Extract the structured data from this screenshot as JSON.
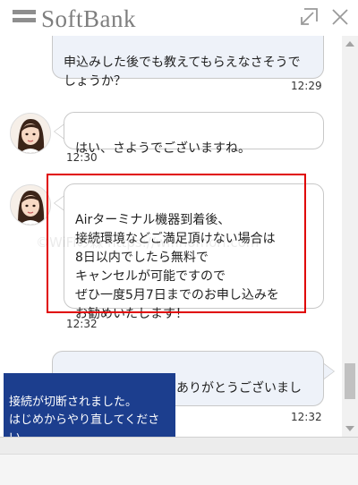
{
  "header": {
    "logo_text": "SoftBank",
    "minimize_icon": "minimize-arrow-icon",
    "close_icon": "close-icon"
  },
  "messages": [
    {
      "sender": "user",
      "text": "申込みした後でも教えてもらえなさそうで\nしょうか？",
      "time": "12:29"
    },
    {
      "sender": "agent",
      "text": "はい、さようでございますね。",
      "time": "12:30"
    },
    {
      "sender": "agent",
      "text": "Airターミナル機器到着後、\n接続環境などご満足頂けない場合は\n8日以内でしたら無料で\nキャンセルが可能ですので\nぜひ一度5月7日までのお申し込みを\nお勧めいたします！",
      "time": "12:32"
    },
    {
      "sender": "user",
      "text": "かしこまりました。ありがとうございまし\nた",
      "time": "12:32"
    }
  ],
  "notice": {
    "text": "接続が切断されました。\nはじめからやり直してください"
  },
  "watermark": "©WiFiの森 https://wifinomori.com",
  "colors": {
    "user_bubble": "#eef2f9",
    "notice_bg": "#1c3e8e",
    "highlight": "#e00000",
    "logo": "#8e8e8e"
  }
}
